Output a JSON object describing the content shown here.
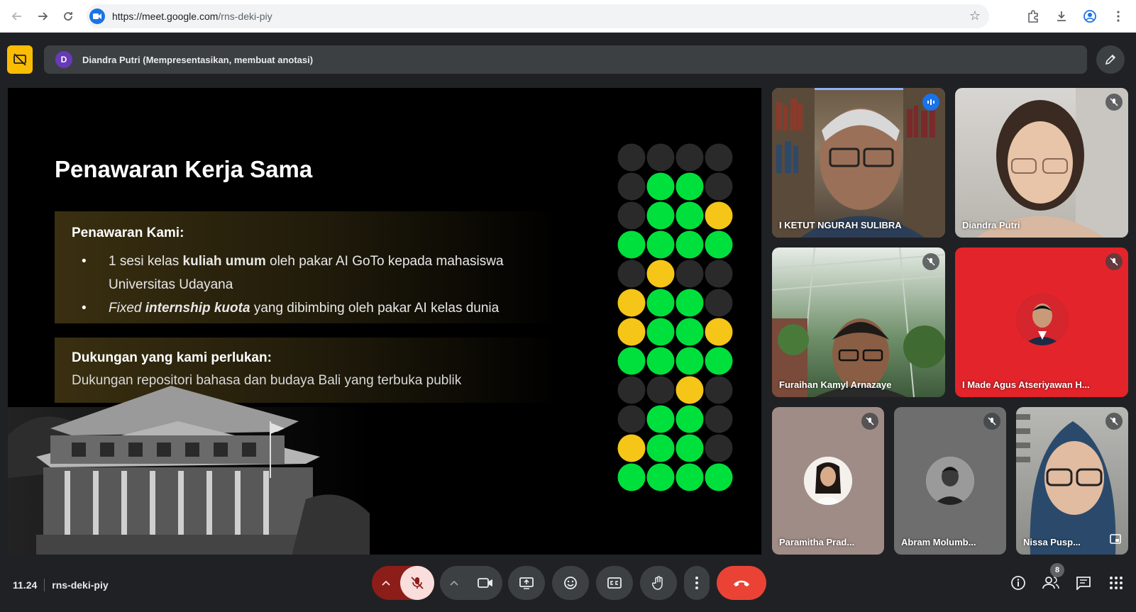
{
  "browser": {
    "url_host": "https://meet.google.com",
    "url_path": "/rns-deki-piy"
  },
  "presenter_bar": {
    "avatar_letter": "D",
    "text": "Diandra Putri (Mempresentasikan, membuat anotasi)"
  },
  "slide": {
    "title": "Penawaran Kerja Sama",
    "offer_heading": "Penawaran Kami:",
    "offer_items": [
      {
        "prefix": "1 sesi kelas ",
        "bold": "kuliah umum",
        "suffix": " oleh pakar AI GoTo kepada mahasiswa Universitas Udayana"
      },
      {
        "italic": "Fixed ",
        "bold_italic": "internship kuota",
        "suffix": " yang dibimbing oleh pakar AI kelas dunia"
      }
    ],
    "support_heading": "Dukungan yang kami perlukan:",
    "support_text": "Dukungan repositori bahasa dan budaya Bali yang terbuka publik",
    "dot_grid": {
      "colors": {
        "g": "#00e03c",
        "y": "#f5c518",
        "d": "#2a2a2a"
      },
      "rows": [
        "dddd",
        "dggd",
        "dggy",
        "gggg",
        "dydd",
        "yggd",
        "yggy",
        "gggg",
        "ddyd",
        "dggd",
        "yggd",
        "gggg"
      ]
    }
  },
  "participants": [
    {
      "name": "I KETUT NGURAH SULIBRA",
      "speaking": true
    },
    {
      "name": "Diandra Putri",
      "muted": true
    },
    {
      "name": "Furaihan Kamyl Arnazaye",
      "muted": true
    },
    {
      "name": "I Made Agus Atseriyawan H...",
      "muted": true
    },
    {
      "name": "Paramitha Prad...",
      "muted": true
    },
    {
      "name": "Abram Molumb...",
      "muted": true
    },
    {
      "name": "Nissa Pusp...",
      "muted": true
    }
  ],
  "bottom_bar": {
    "time": "11.24",
    "meeting_code": "rns-deki-piy",
    "people_count": "8"
  },
  "colors": {
    "end_call": "#ea4335",
    "mic_off_bg": "#f9dedc",
    "mic_caret_bg": "#8c1d18",
    "accent_yellow": "#fbbc04"
  }
}
